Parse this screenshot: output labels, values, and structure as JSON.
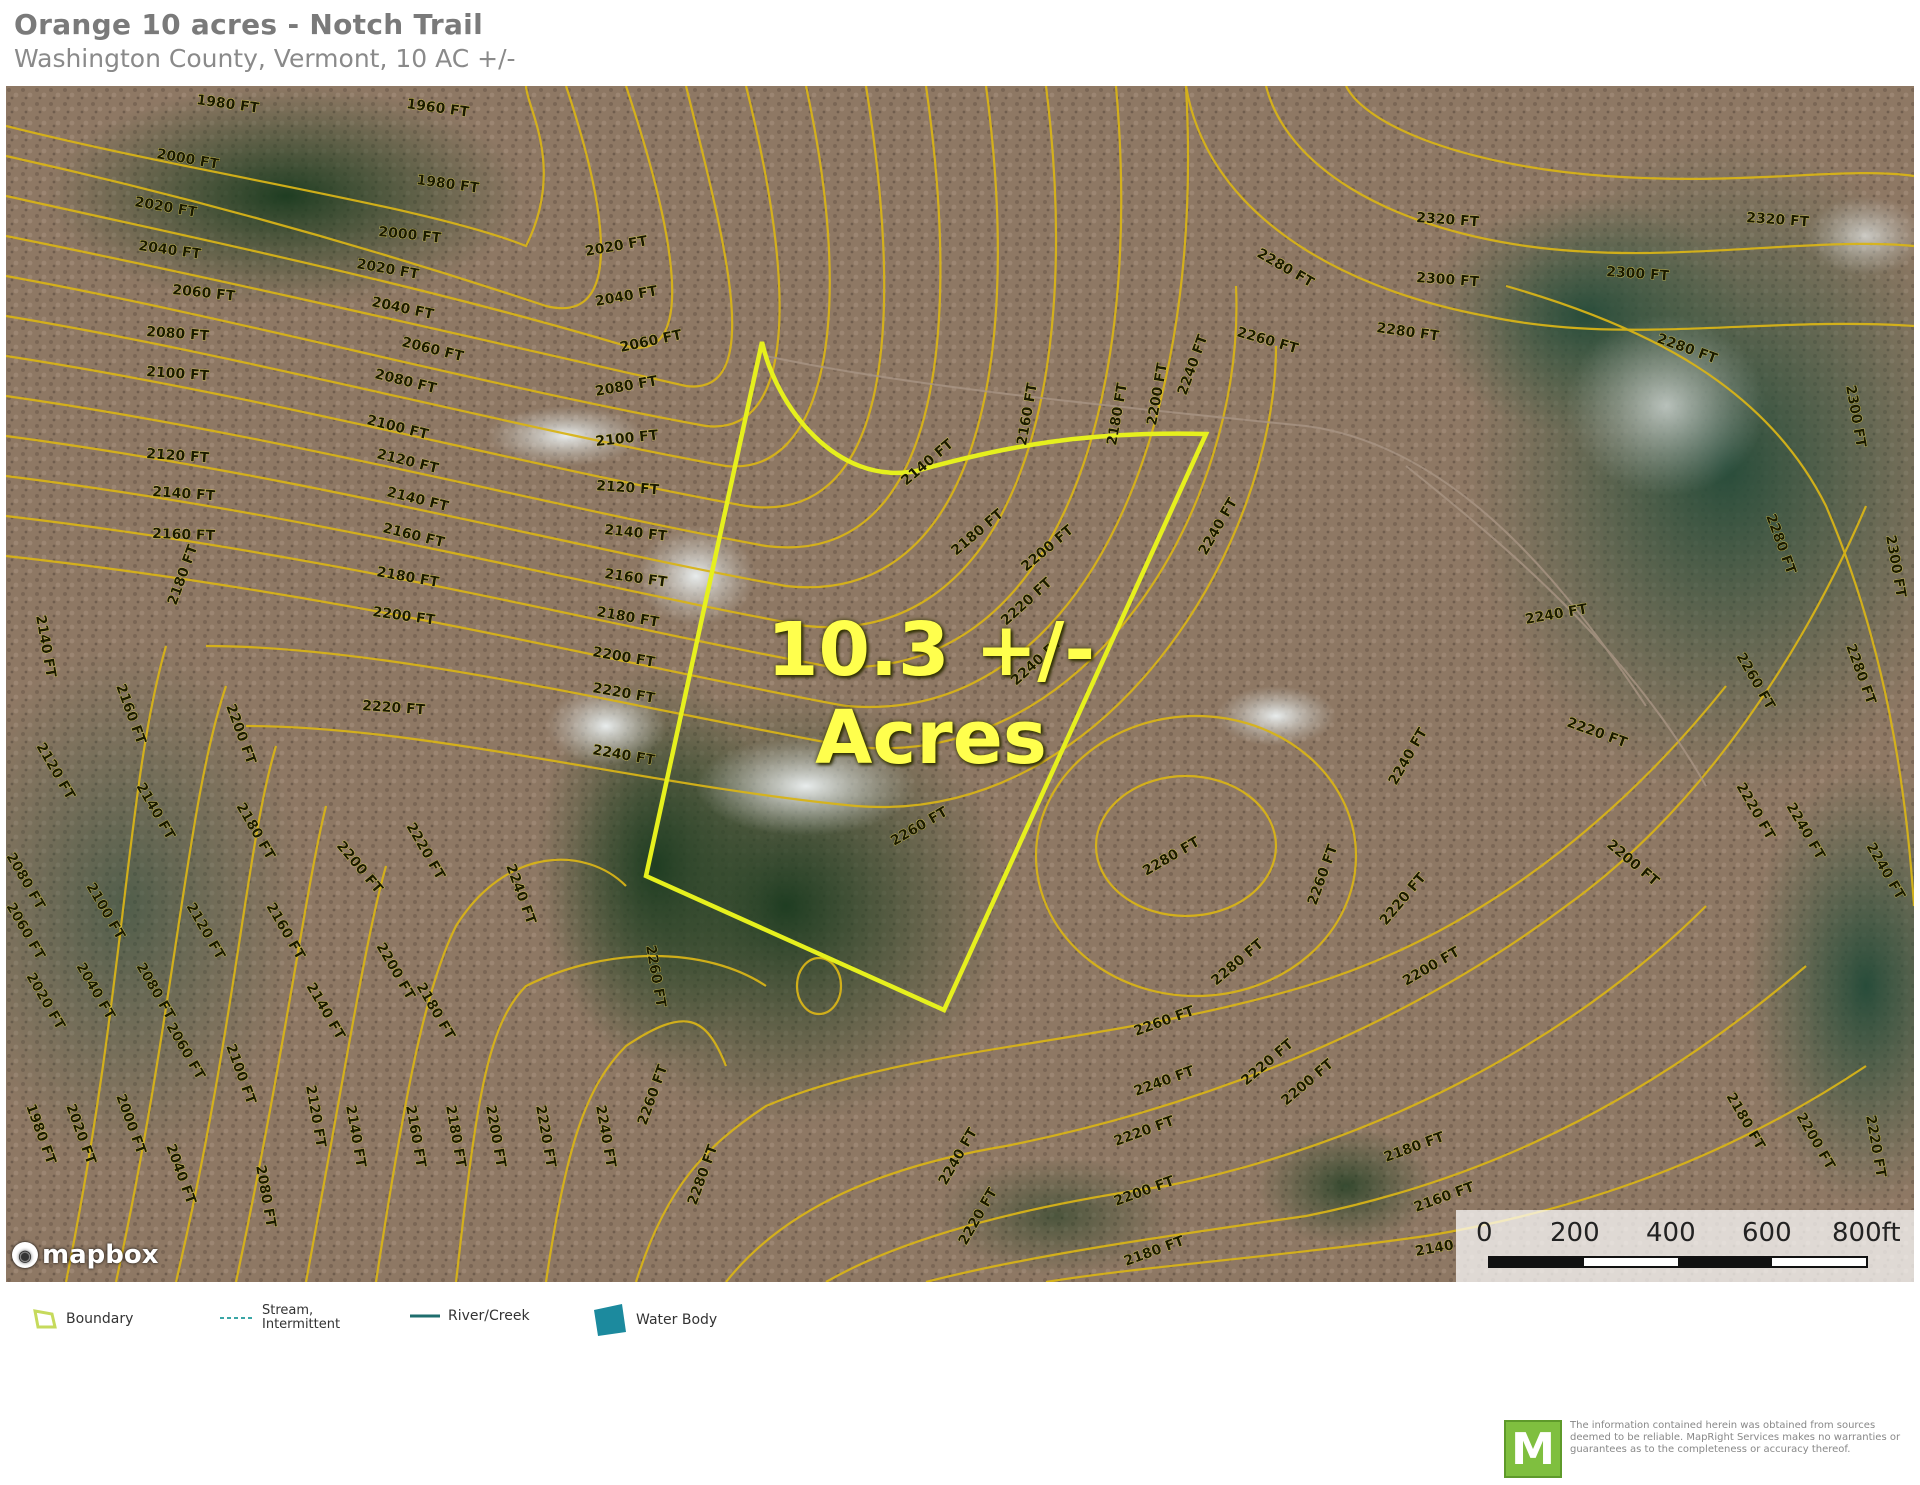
{
  "header": {
    "title": "Orange 10 acres - Notch Trail",
    "subtitle": "Washington County, Vermont, 10 AC +/-"
  },
  "map": {
    "parcel_label_line1": "10.3 +/-",
    "parcel_label_line2": "Acres",
    "boundary_color": "#e6f01e",
    "contour_color": "#d8b418",
    "attribution": "mapbox",
    "contour_labels": [
      "1960 FT",
      "1980 FT",
      "2000 FT",
      "2020 FT",
      "2040 FT",
      "2060 FT",
      "2080 FT",
      "2100 FT",
      "2120 FT",
      "2140 FT",
      "2160 FT",
      "2180 FT",
      "2200 FT",
      "2220 FT",
      "2240 FT",
      "2260 FT",
      "2280 FT",
      "2300 FT",
      "2320 FT"
    ]
  },
  "scale": {
    "ticks": [
      "0",
      "200",
      "400",
      "600",
      "800ft"
    ]
  },
  "legend": {
    "boundary": "Boundary",
    "stream_line1": "Stream,",
    "stream_line2": "Intermittent",
    "river": "River/Creek",
    "water_body": "Water Body"
  },
  "disclaimer": {
    "logo_letter": "M",
    "text": "The information contained herein was obtained from sources deemed to be reliable. MapRight Services makes no warranties or guarantees as to the completeness or accuracy thereof."
  }
}
